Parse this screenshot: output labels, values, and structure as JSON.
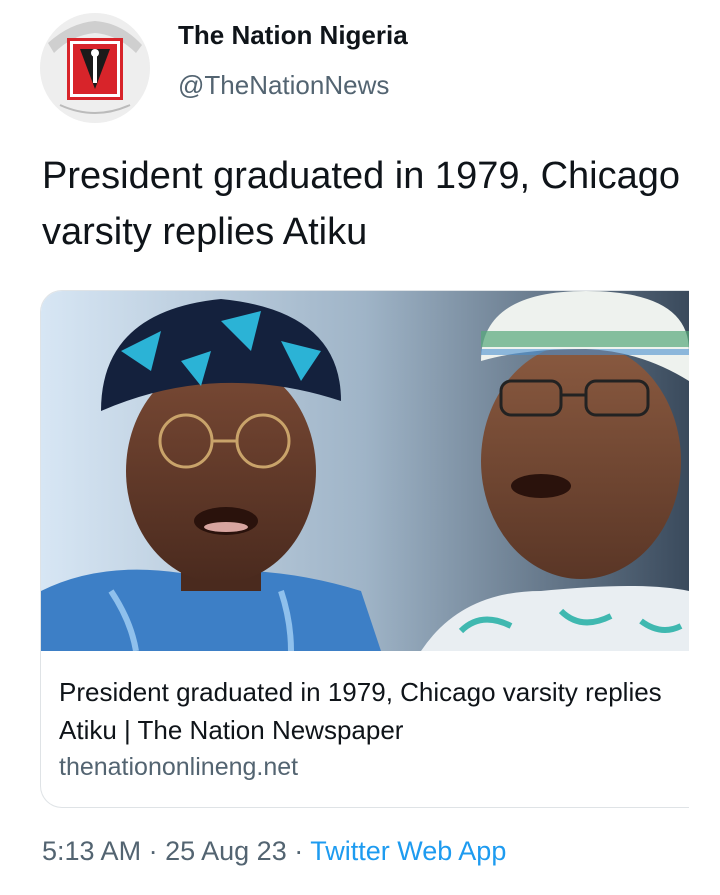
{
  "tweet": {
    "author": {
      "display_name": "The Nation Nigeria",
      "handle": "@TheNationNews",
      "avatar_icon": "the-nation-logo"
    },
    "text": "President graduated in 1979, Chicago varsity replies Atiku",
    "link_card": {
      "image_description_icon": "news-photo",
      "title": "President graduated in 1979, Chicago varsity replies Atiku | The Nation Newspaper",
      "domain": "thenationonlineng.net"
    },
    "time": "5:13 AM",
    "separator": "·",
    "date": "25 Aug 23",
    "source": "Twitter Web App"
  },
  "colors": {
    "text_primary": "#0f1419",
    "text_secondary": "#536471",
    "link_blue": "#1d9bf0",
    "logo_red": "#d8242a"
  }
}
